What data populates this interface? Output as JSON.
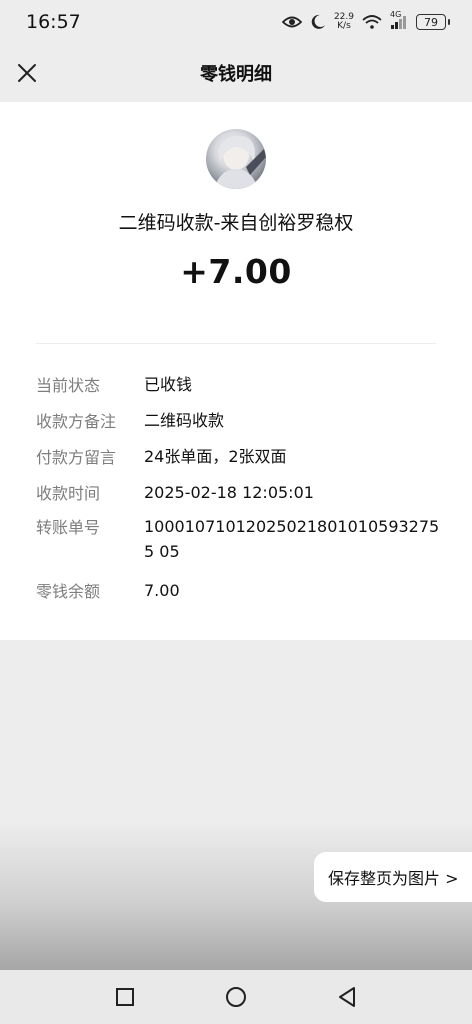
{
  "status_bar": {
    "time": "16:57",
    "net_speed_value": "22.9",
    "net_speed_unit": "K/s",
    "network_type": "4G",
    "battery": "79"
  },
  "nav": {
    "title": "零钱明细"
  },
  "transaction": {
    "payer": "二维码收款-来自创裕罗稳权",
    "amount": "+7.00",
    "details": [
      {
        "label": "当前状态",
        "value": "已收钱"
      },
      {
        "label": "收款方备注",
        "value": "二维码收款"
      },
      {
        "label": "付款方留言",
        "value": "24张单面，2张双面"
      },
      {
        "label": "收款时间",
        "value": "2025-02-18 12:05:01"
      },
      {
        "label": "转账单号",
        "value": "100010710120250218010105932755 05"
      },
      {
        "label": "零钱余额",
        "value": "7.00"
      }
    ]
  },
  "save_button": {
    "label": "保存整页为图片 >"
  }
}
